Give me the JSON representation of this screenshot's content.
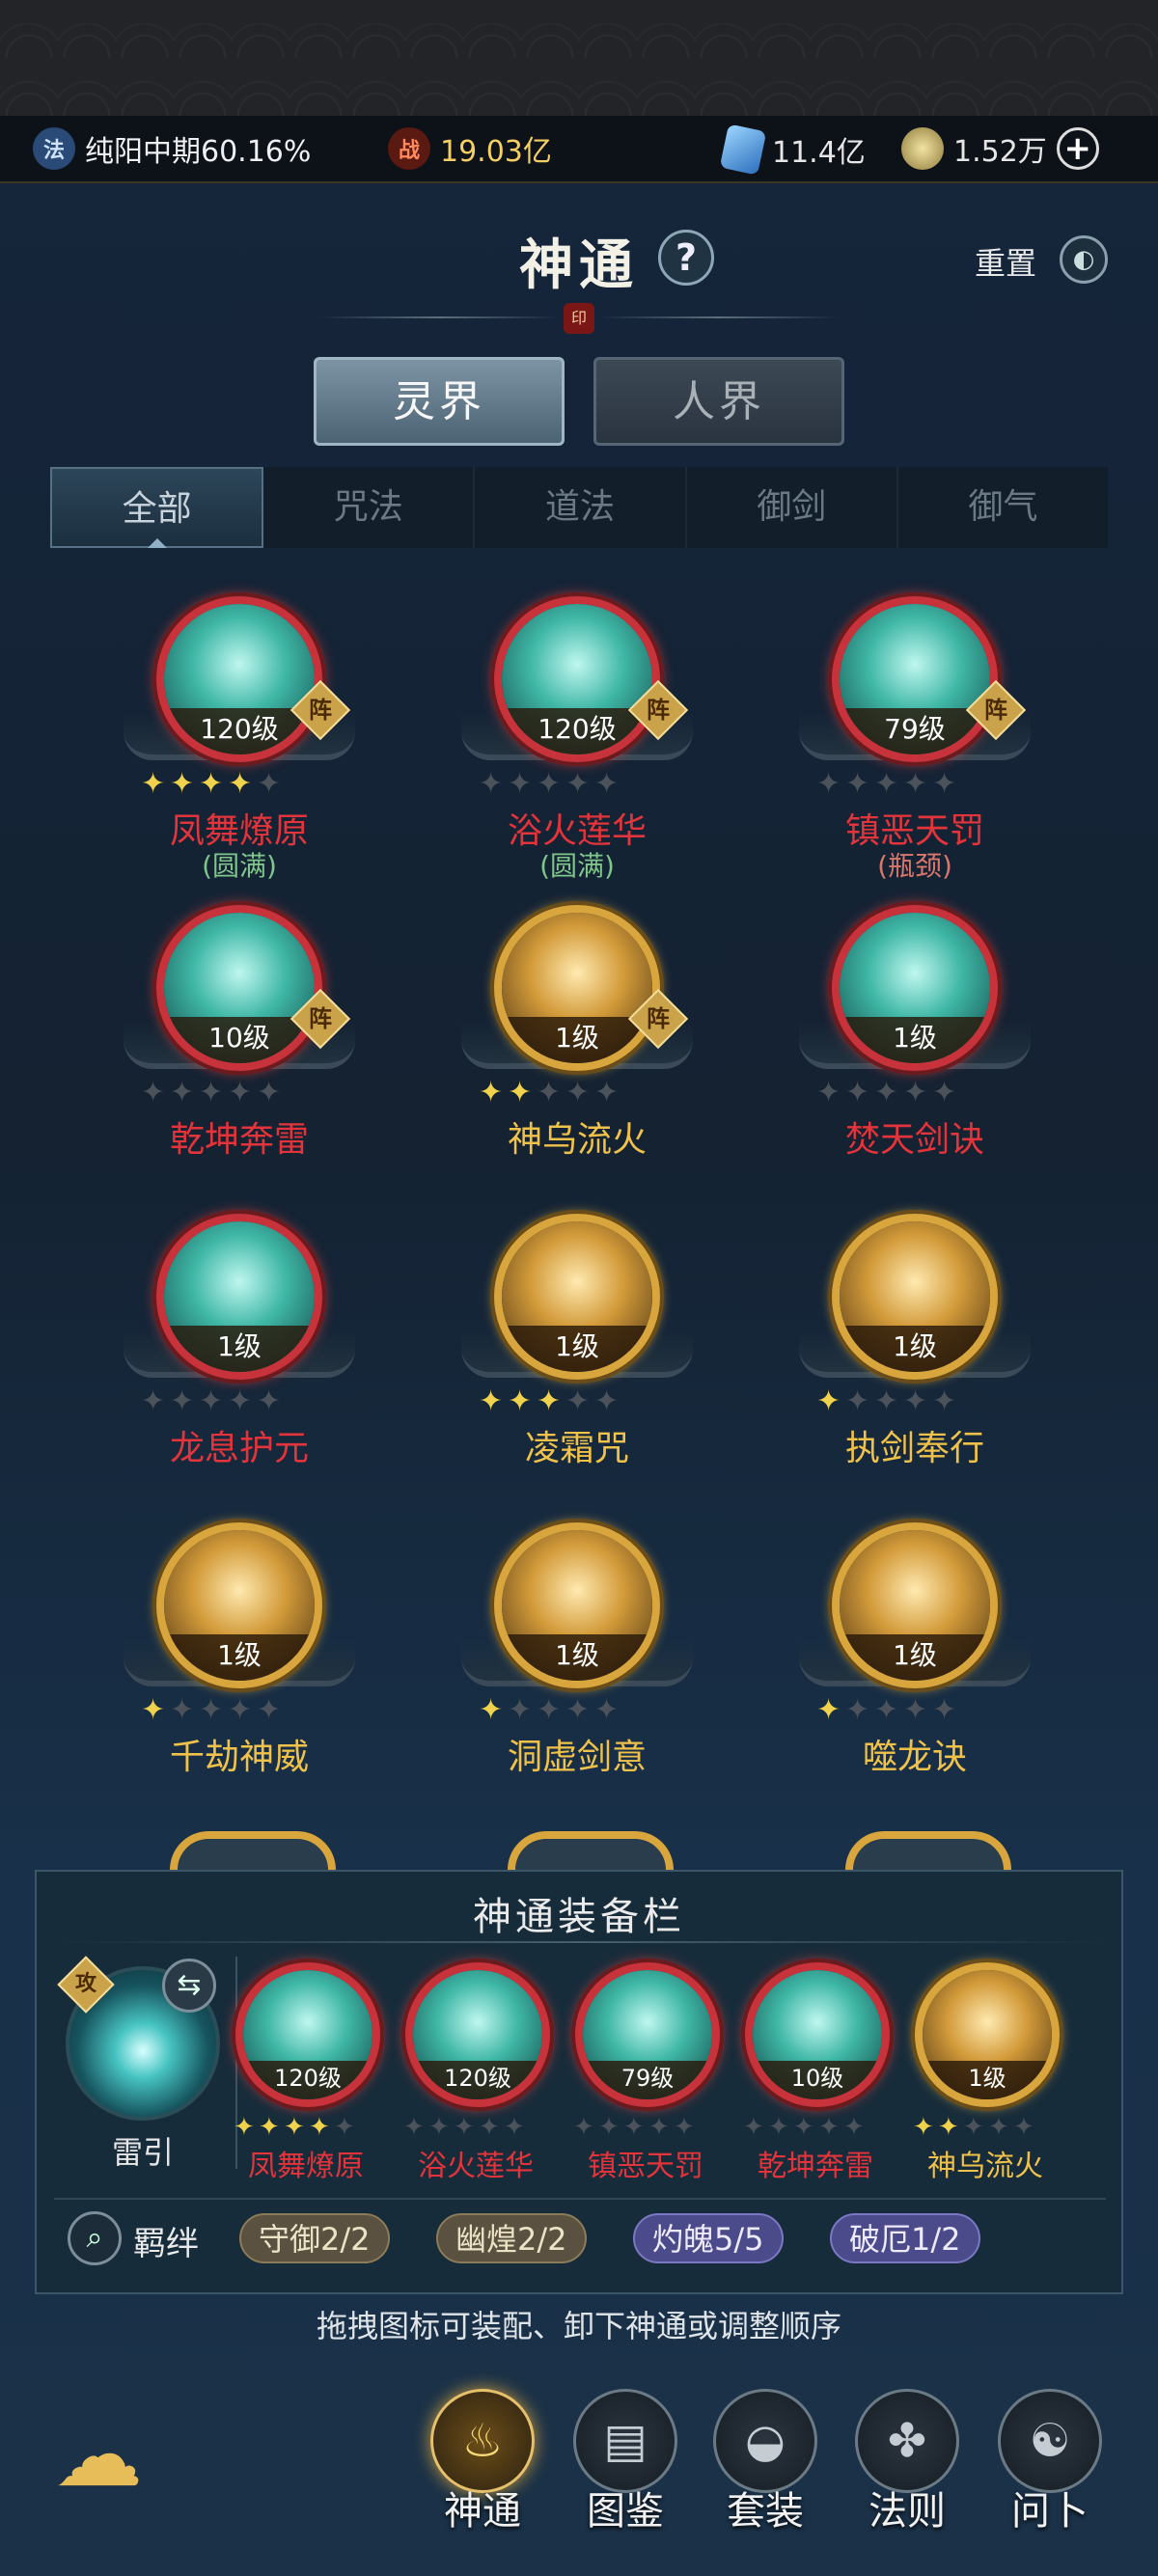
{
  "resources": {
    "realm_icon": "法",
    "realm_text": "纯阳中期60.16%",
    "power_icon": "战",
    "power_value": "19.03亿",
    "crystal_value": "11.4亿",
    "spirit_value": "1.52万",
    "add_symbol": "+"
  },
  "header": {
    "title": "神通",
    "help": "?",
    "reset_label": "重置",
    "seal": "印"
  },
  "realm_tabs": [
    "灵界",
    "人界"
  ],
  "filter_tabs": [
    "全部",
    "咒法",
    "道法",
    "御剑",
    "御气"
  ],
  "skills": [
    {
      "name": "凤舞燎原",
      "level": "120级",
      "stars": 4,
      "badge": "阵",
      "status": "(圆满)",
      "frame": "red"
    },
    {
      "name": "浴火莲华",
      "level": "120级",
      "stars": 0,
      "badge": "阵",
      "status": "(圆满)",
      "frame": "red"
    },
    {
      "name": "镇恶天罚",
      "level": "79级",
      "stars": 0,
      "badge": "阵",
      "status": "(瓶颈)",
      "frame": "red"
    },
    {
      "name": "乾坤奔雷",
      "level": "10级",
      "stars": 0,
      "badge": "阵",
      "status": "",
      "frame": "red"
    },
    {
      "name": "神乌流火",
      "level": "1级",
      "stars": 2,
      "badge": "阵",
      "status": "",
      "frame": "gold"
    },
    {
      "name": "焚天剑诀",
      "level": "1级",
      "stars": 0,
      "badge": "",
      "status": "",
      "frame": "red"
    },
    {
      "name": "龙息护元",
      "level": "1级",
      "stars": 0,
      "badge": "",
      "status": "",
      "frame": "red"
    },
    {
      "name": "凌霜咒",
      "level": "1级",
      "stars": 3,
      "badge": "",
      "status": "",
      "frame": "gold"
    },
    {
      "name": "执剑奉行",
      "level": "1级",
      "stars": 1,
      "badge": "",
      "status": "",
      "frame": "gold"
    },
    {
      "name": "千劫神威",
      "level": "1级",
      "stars": 1,
      "badge": "",
      "status": "",
      "frame": "gold"
    },
    {
      "name": "洞虚剑意",
      "level": "1级",
      "stars": 1,
      "badge": "",
      "status": "",
      "frame": "gold"
    },
    {
      "name": "噬龙诀",
      "level": "1级",
      "stars": 1,
      "badge": "",
      "status": "",
      "frame": "gold"
    }
  ],
  "equip": {
    "title": "神通装备栏",
    "main_skill": {
      "name": "雷引",
      "tag": "攻"
    },
    "slots": [
      {
        "name": "凤舞燎原",
        "level": "120级",
        "stars": 4,
        "frame": "red"
      },
      {
        "name": "浴火莲华",
        "level": "120级",
        "stars": 0,
        "frame": "red"
      },
      {
        "name": "镇恶天罚",
        "level": "79级",
        "stars": 0,
        "frame": "red"
      },
      {
        "name": "乾坤奔雷",
        "level": "10级",
        "stars": 0,
        "frame": "red"
      },
      {
        "name": "神乌流火",
        "level": "1级",
        "stars": 2,
        "frame": "gold"
      }
    ],
    "bond_label": "羁绊",
    "bonds": [
      {
        "label": "守御2/2",
        "style": "bronze"
      },
      {
        "label": "幽煌2/2",
        "style": "bronze"
      },
      {
        "label": "灼魄5/5",
        "style": "purple"
      },
      {
        "label": "破厄1/2",
        "style": "purple"
      }
    ],
    "hint": "拖拽图标可装配、卸下神通或调整顺序"
  },
  "nav": [
    {
      "label": "神通",
      "icon": "flame-icon"
    },
    {
      "label": "图鉴",
      "icon": "book-icon"
    },
    {
      "label": "套装",
      "icon": "fan-icon"
    },
    {
      "label": "法则",
      "icon": "rune-icon"
    },
    {
      "label": "问卜",
      "icon": "divination-icon"
    }
  ],
  "colors": {
    "red_frame": "#c8323a",
    "gold_frame": "#d8a63c",
    "name_red": "#e2343a",
    "name_gold": "#f0c24a",
    "star_on": "#f0d24c"
  }
}
